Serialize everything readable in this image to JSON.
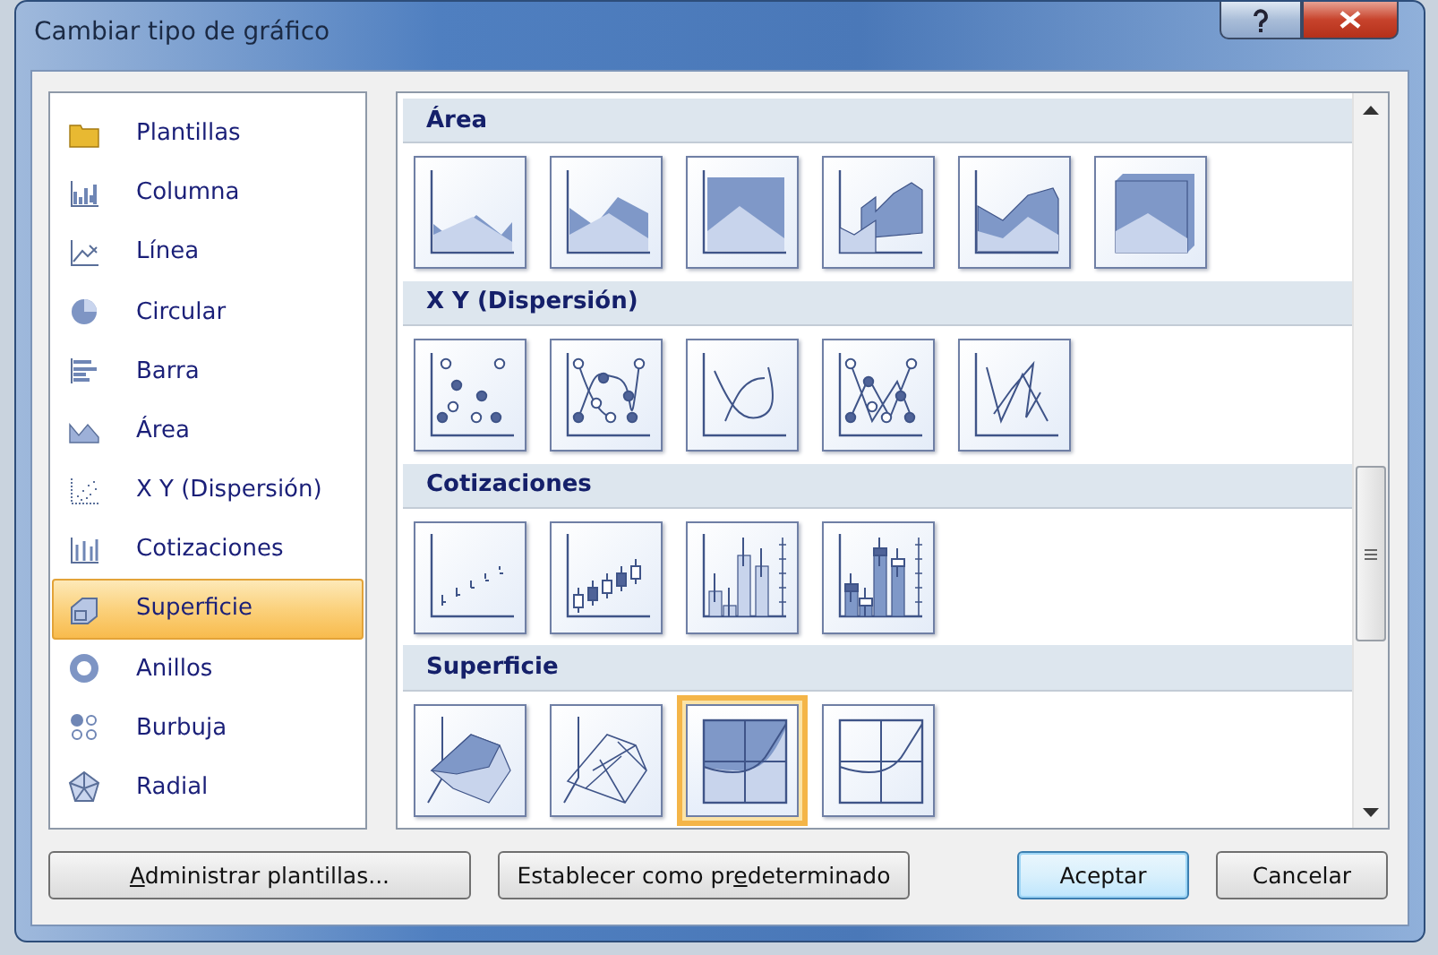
{
  "window": {
    "title": "Cambiar tipo de gráfico"
  },
  "sidebar": {
    "items": [
      {
        "label": "Plantillas",
        "kind": "folder",
        "selected": false
      },
      {
        "label": "Columna",
        "kind": "column",
        "selected": false
      },
      {
        "label": "Línea",
        "kind": "line",
        "selected": false
      },
      {
        "label": "Circular",
        "kind": "pie",
        "selected": false
      },
      {
        "label": "Barra",
        "kind": "bar",
        "selected": false
      },
      {
        "label": "Área",
        "kind": "area",
        "selected": false
      },
      {
        "label": "X Y (Dispersión)",
        "kind": "scatter",
        "selected": false
      },
      {
        "label": "Cotizaciones",
        "kind": "stock",
        "selected": false
      },
      {
        "label": "Superficie",
        "kind": "surface",
        "selected": true
      },
      {
        "label": "Anillos",
        "kind": "doughnut",
        "selected": false
      },
      {
        "label": "Burbuja",
        "kind": "bubble",
        "selected": false
      },
      {
        "label": "Radial",
        "kind": "radar",
        "selected": false
      }
    ]
  },
  "gallery": {
    "sections": [
      {
        "title": "Área",
        "items": [
          {
            "kind": "area",
            "selected": false
          },
          {
            "kind": "area-stacked",
            "selected": false
          },
          {
            "kind": "area-full",
            "selected": false
          },
          {
            "kind": "area-3d",
            "selected": false
          },
          {
            "kind": "area-3d-stacked",
            "selected": false
          },
          {
            "kind": "area-3d-full",
            "selected": false
          }
        ]
      },
      {
        "title": "X Y (Dispersión)",
        "items": [
          {
            "kind": "scatter-markers",
            "selected": false
          },
          {
            "kind": "scatter-smooth-markers",
            "selected": false
          },
          {
            "kind": "scatter-smooth",
            "selected": false
          },
          {
            "kind": "scatter-lines-markers",
            "selected": false
          },
          {
            "kind": "scatter-lines",
            "selected": false
          }
        ]
      },
      {
        "title": "Cotizaciones",
        "items": [
          {
            "kind": "stock-hlc",
            "selected": false
          },
          {
            "kind": "stock-ohlc",
            "selected": false
          },
          {
            "kind": "stock-vhlc",
            "selected": false
          },
          {
            "kind": "stock-vohlc",
            "selected": false
          }
        ]
      },
      {
        "title": "Superficie",
        "items": [
          {
            "kind": "surface",
            "selected": false
          },
          {
            "kind": "surface-wireframe",
            "selected": false
          },
          {
            "kind": "contour",
            "selected": true
          },
          {
            "kind": "contour-wireframe",
            "selected": false
          }
        ]
      }
    ]
  },
  "buttons": [
    {
      "key": "A",
      "after": "dministrar plantillas...",
      "kind": "left"
    },
    {
      "before": "Establecer como pr",
      "key": "e",
      "after": "determinado",
      "kind": "left"
    },
    {
      "before": "Aceptar",
      "kind": "default"
    },
    {
      "before": "Cancelar",
      "kind": "right"
    }
  ]
}
